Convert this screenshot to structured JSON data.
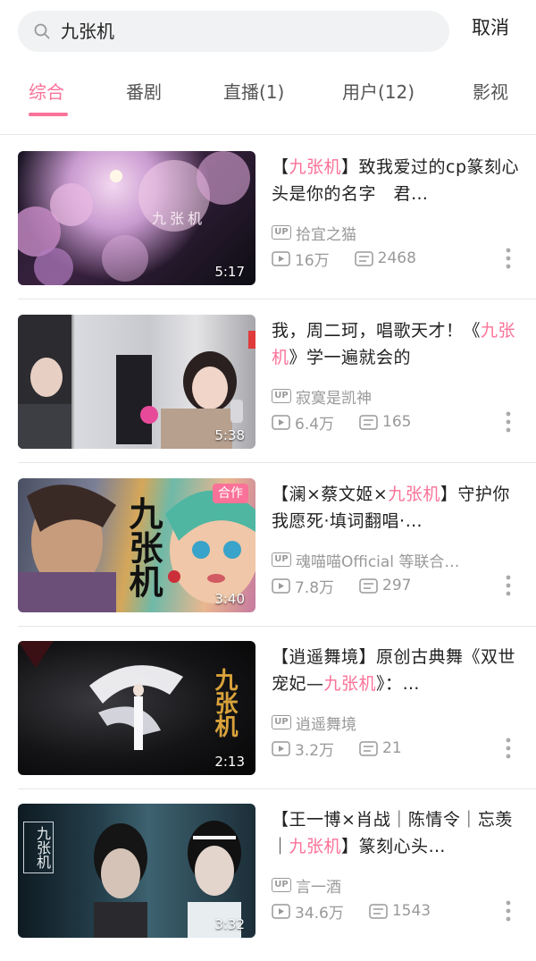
{
  "search": {
    "query": "九张机",
    "cancel_label": "取消"
  },
  "tabs": [
    {
      "label": "综合",
      "active": true
    },
    {
      "label": "番剧",
      "active": false
    },
    {
      "label": "直播(1)",
      "active": false
    },
    {
      "label": "用户(12)",
      "active": false
    },
    {
      "label": "影视",
      "active": false
    }
  ],
  "colors": {
    "accent": "#fb7299",
    "muted": "#999999",
    "text": "#222222"
  },
  "videos": [
    {
      "title_parts": [
        "【",
        "九张机",
        "】致我爱过的cp篆刻心头是你的名字　君…"
      ],
      "thumb_text": "九张机",
      "up_name": "拾宜之猫",
      "views": "16万",
      "danmaku": "2468",
      "duration": "5:17",
      "badge": ""
    },
    {
      "title_parts": [
        "我，周二珂，唱歌天才！《",
        "九张机",
        "》学一遍就会的"
      ],
      "thumb_text": "",
      "up_name": "寂寞是凯神",
      "views": "6.4万",
      "danmaku": "165",
      "duration": "5:38",
      "badge": ""
    },
    {
      "title_parts": [
        "【澜×蔡文姬×",
        "九张机",
        "】守护你我愿死·填词翻唱·…"
      ],
      "thumb_text": "九张机",
      "up_name": "魂喵喵Official 等联合…",
      "views": "7.8万",
      "danmaku": "297",
      "duration": "3:40",
      "badge": "合作"
    },
    {
      "title_parts": [
        "【逍遥舞境】原创古典舞《双世宠妃—",
        "九张机",
        "》：…"
      ],
      "thumb_text": "九张机",
      "up_name": "逍遥舞境",
      "views": "3.2万",
      "danmaku": "21",
      "duration": "2:13",
      "badge": ""
    },
    {
      "title_parts": [
        "【王一博×肖战｜陈情令｜忘羡｜",
        "九张机",
        "】篆刻心头…"
      ],
      "thumb_text": "九张机",
      "up_name": "言一酒",
      "views": "34.6万",
      "danmaku": "1543",
      "duration": "3:32",
      "badge": ""
    }
  ]
}
